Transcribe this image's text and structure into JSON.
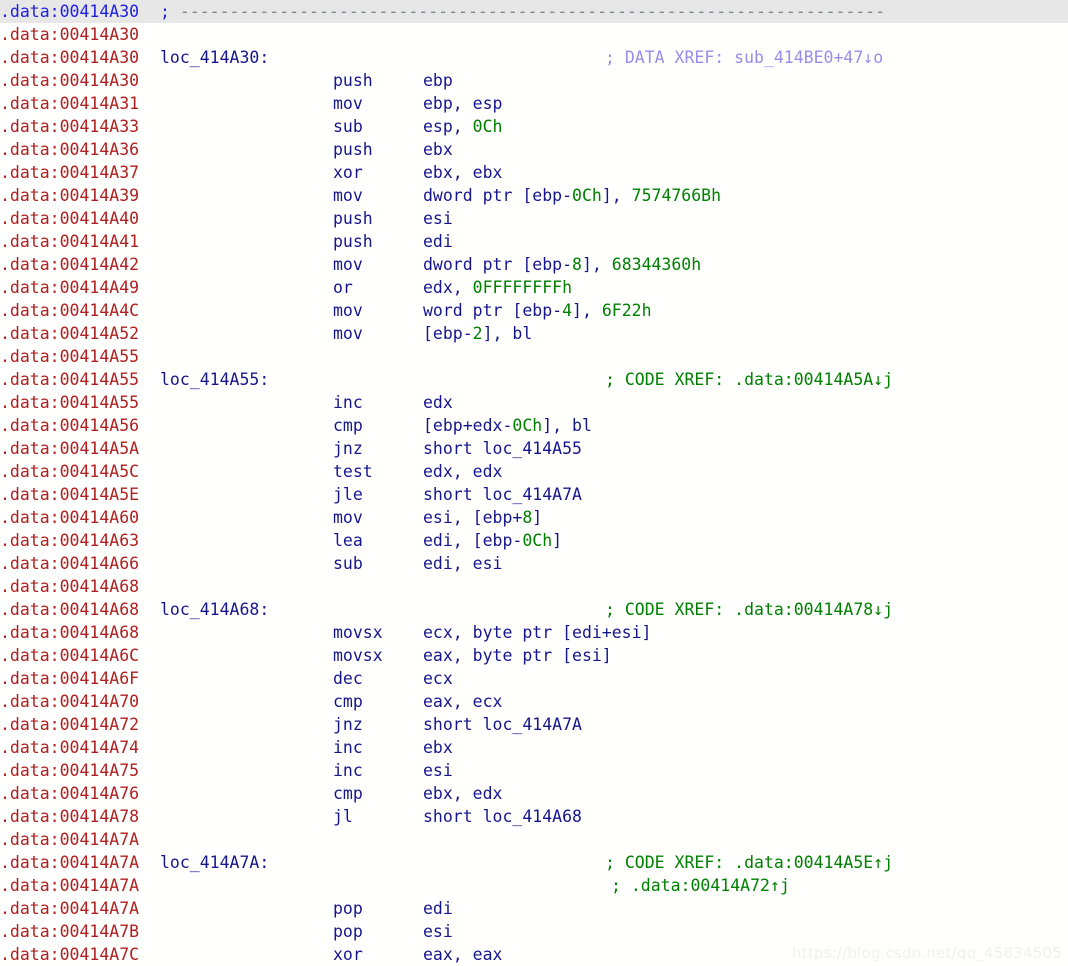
{
  "view": {
    "name": "IDA Pro disassembly listing",
    "segment": "data",
    "watermark": "https://blog.csdn.net/qq_45834505",
    "colors": {
      "background": "#fffffe",
      "highlight_row": "#e7e7e7",
      "address": "#b02020",
      "code": "#16168c",
      "number": "#008000",
      "code_xref_comment": "#008000",
      "data_xref_comment": "#9b8ce8",
      "separator_dash": "#7d8490",
      "highlight_text": "#2020e0"
    }
  },
  "separator": {
    "semicolon": ";",
    "dashes": "-----------------------------------------------------------------------"
  },
  "lines": [
    {
      "addr": ".data:00414A30",
      "sep": true,
      "highlight": true
    },
    {
      "addr": ".data:00414A30"
    },
    {
      "addr": ".data:00414A30",
      "label": "loc_414A30:",
      "comment": "; DATA XREF: sub_414BE0+47↓o",
      "comment_kind": "data"
    },
    {
      "addr": ".data:00414A30",
      "mnem": "push",
      "oper": "ebp"
    },
    {
      "addr": ".data:00414A31",
      "mnem": "mov",
      "oper": "ebp, esp"
    },
    {
      "addr": ".data:00414A33",
      "mnem": "sub",
      "oper": "esp, {0Ch}"
    },
    {
      "addr": ".data:00414A36",
      "mnem": "push",
      "oper": "ebx"
    },
    {
      "addr": ".data:00414A37",
      "mnem": "xor",
      "oper": "ebx, ebx"
    },
    {
      "addr": ".data:00414A39",
      "mnem": "mov",
      "oper": "dword ptr [ebp-{0Ch}], {7574766Bh}"
    },
    {
      "addr": ".data:00414A40",
      "mnem": "push",
      "oper": "esi"
    },
    {
      "addr": ".data:00414A41",
      "mnem": "push",
      "oper": "edi"
    },
    {
      "addr": ".data:00414A42",
      "mnem": "mov",
      "oper": "dword ptr [ebp-{8}], {68344360h}"
    },
    {
      "addr": ".data:00414A49",
      "mnem": "or",
      "oper": "edx, {0FFFFFFFFh}"
    },
    {
      "addr": ".data:00414A4C",
      "mnem": "mov",
      "oper": "word ptr [ebp-{4}], {6F22h}"
    },
    {
      "addr": ".data:00414A52",
      "mnem": "mov",
      "oper": "[ebp-{2}], bl"
    },
    {
      "addr": ".data:00414A55"
    },
    {
      "addr": ".data:00414A55",
      "label": "loc_414A55:",
      "comment": "; CODE XREF: .data:00414A5A↓j",
      "comment_kind": "code"
    },
    {
      "addr": ".data:00414A55",
      "mnem": "inc",
      "oper": "edx"
    },
    {
      "addr": ".data:00414A56",
      "mnem": "cmp",
      "oper": "[ebp+edx-{0Ch}], bl"
    },
    {
      "addr": ".data:00414A5A",
      "mnem": "jnz",
      "oper": "short loc_414A55"
    },
    {
      "addr": ".data:00414A5C",
      "mnem": "test",
      "oper": "edx, edx"
    },
    {
      "addr": ".data:00414A5E",
      "mnem": "jle",
      "oper": "short loc_414A7A"
    },
    {
      "addr": ".data:00414A60",
      "mnem": "mov",
      "oper": "esi, [ebp+{8}]"
    },
    {
      "addr": ".data:00414A63",
      "mnem": "lea",
      "oper": "edi, [ebp-{0Ch}]"
    },
    {
      "addr": ".data:00414A66",
      "mnem": "sub",
      "oper": "edi, esi"
    },
    {
      "addr": ".data:00414A68"
    },
    {
      "addr": ".data:00414A68",
      "label": "loc_414A68:",
      "comment": "; CODE XREF: .data:00414A78↓j",
      "comment_kind": "code"
    },
    {
      "addr": ".data:00414A68",
      "mnem": "movsx",
      "oper": "ecx, byte ptr [edi+esi]"
    },
    {
      "addr": ".data:00414A6C",
      "mnem": "movsx",
      "oper": "eax, byte ptr [esi]"
    },
    {
      "addr": ".data:00414A6F",
      "mnem": "dec",
      "oper": "ecx"
    },
    {
      "addr": ".data:00414A70",
      "mnem": "cmp",
      "oper": "eax, ecx"
    },
    {
      "addr": ".data:00414A72",
      "mnem": "jnz",
      "oper": "short loc_414A7A"
    },
    {
      "addr": ".data:00414A74",
      "mnem": "inc",
      "oper": "ebx"
    },
    {
      "addr": ".data:00414A75",
      "mnem": "inc",
      "oper": "esi"
    },
    {
      "addr": ".data:00414A76",
      "mnem": "cmp",
      "oper": "ebx, edx"
    },
    {
      "addr": ".data:00414A78",
      "mnem": "jl",
      "oper": "short loc_414A68"
    },
    {
      "addr": ".data:00414A7A"
    },
    {
      "addr": ".data:00414A7A",
      "label": "loc_414A7A:",
      "comment": "; CODE XREF: .data:00414A5E↑j",
      "comment_kind": "code"
    },
    {
      "addr": ".data:00414A7A",
      "comment": "; .data:00414A72↑j",
      "comment_kind": "code",
      "comment_cont": true
    },
    {
      "addr": ".data:00414A7A",
      "mnem": "pop",
      "oper": "edi"
    },
    {
      "addr": ".data:00414A7B",
      "mnem": "pop",
      "oper": "esi"
    },
    {
      "addr": ".data:00414A7C",
      "mnem": "xor",
      "oper": "eax, eax"
    }
  ]
}
